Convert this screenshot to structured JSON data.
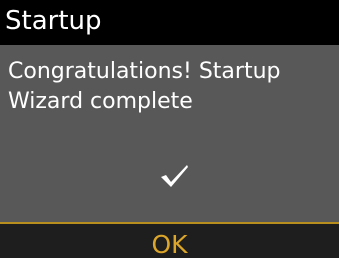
{
  "header": {
    "title": "Startup"
  },
  "main": {
    "message": "Congratulations! Startup Wizard complete",
    "status_icon": "checkmark-icon"
  },
  "footer": {
    "ok_label": "OK"
  },
  "colors": {
    "title_bar": "#000000",
    "content_background": "#585858",
    "footer_background": "#1e1e1e",
    "accent": "#dca62a",
    "divider": "#b88f1e",
    "text": "#ffffff"
  }
}
